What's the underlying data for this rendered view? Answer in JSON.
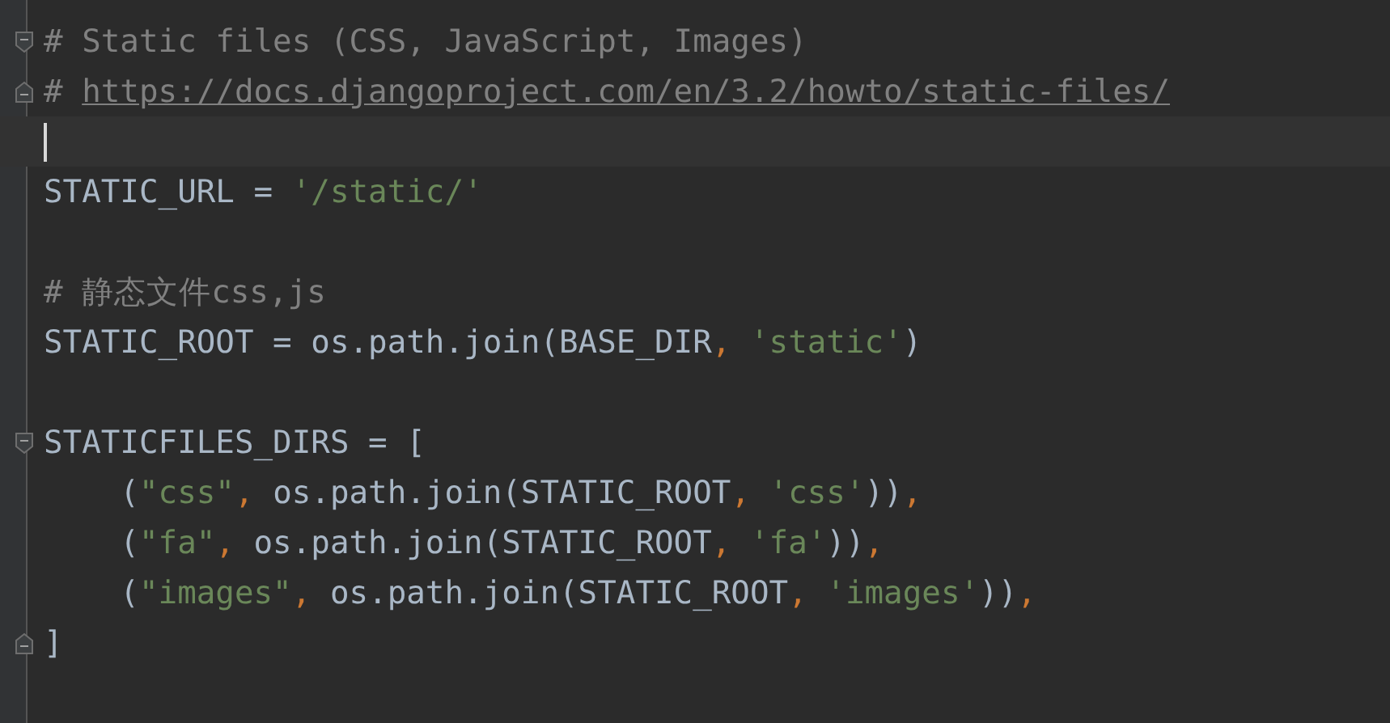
{
  "editor": {
    "lines": [
      {
        "current": false,
        "fold_start": true,
        "fold_end": false,
        "tokens": [
          {
            "kind": "comment",
            "text": "# Static files (CSS, JavaScript, Images)"
          }
        ]
      },
      {
        "current": false,
        "fold_start": false,
        "fold_end": true,
        "tokens": [
          {
            "kind": "comment",
            "text": "# "
          },
          {
            "kind": "link",
            "text": "https://docs.djangoproject.com/en/3.2/howto/static-files/"
          }
        ]
      },
      {
        "current": true,
        "fold_start": false,
        "fold_end": false
      },
      {
        "current": false,
        "fold_start": false,
        "fold_end": false,
        "tokens": [
          {
            "kind": "plain",
            "text": "STATIC_URL = "
          },
          {
            "kind": "string",
            "text": "'/static/'"
          }
        ]
      },
      {
        "current": false,
        "fold_start": false,
        "fold_end": false
      },
      {
        "current": false,
        "fold_start": false,
        "fold_end": false,
        "tokens": [
          {
            "kind": "comment",
            "text": "# 静态文件css,js"
          }
        ]
      },
      {
        "current": false,
        "fold_start": false,
        "fold_end": false,
        "tokens": [
          {
            "kind": "plain",
            "text": "STATIC_ROOT = os.path.join(BASE_DIR"
          },
          {
            "kind": "punct",
            "text": ", "
          },
          {
            "kind": "string",
            "text": "'static'"
          },
          {
            "kind": "plain",
            "text": ")"
          }
        ]
      },
      {
        "current": false,
        "fold_start": false,
        "fold_end": false
      },
      {
        "current": false,
        "fold_start": true,
        "fold_end": false,
        "tokens": [
          {
            "kind": "plain",
            "text": "STATICFILES_DIRS = ["
          }
        ]
      },
      {
        "current": false,
        "fold_start": false,
        "fold_end": false,
        "tokens": [
          {
            "kind": "plain",
            "text": "    ("
          },
          {
            "kind": "string",
            "text": "\"css\""
          },
          {
            "kind": "punct",
            "text": ", "
          },
          {
            "kind": "plain",
            "text": "os.path.join(STATIC_ROOT"
          },
          {
            "kind": "punct",
            "text": ", "
          },
          {
            "kind": "string",
            "text": "'css'"
          },
          {
            "kind": "plain",
            "text": "))"
          },
          {
            "kind": "punct",
            "text": ","
          }
        ]
      },
      {
        "current": false,
        "fold_start": false,
        "fold_end": false,
        "tokens": [
          {
            "kind": "plain",
            "text": "    ("
          },
          {
            "kind": "string",
            "text": "\"fa\""
          },
          {
            "kind": "punct",
            "text": ", "
          },
          {
            "kind": "plain",
            "text": "os.path.join(STATIC_ROOT"
          },
          {
            "kind": "punct",
            "text": ", "
          },
          {
            "kind": "string",
            "text": "'fa'"
          },
          {
            "kind": "plain",
            "text": "))"
          },
          {
            "kind": "punct",
            "text": ","
          }
        ]
      },
      {
        "current": false,
        "fold_start": false,
        "fold_end": false,
        "tokens": [
          {
            "kind": "plain",
            "text": "    ("
          },
          {
            "kind": "string",
            "text": "\"images\""
          },
          {
            "kind": "punct",
            "text": ", "
          },
          {
            "kind": "plain",
            "text": "os.path.join(STATIC_ROOT"
          },
          {
            "kind": "punct",
            "text": ", "
          },
          {
            "kind": "string",
            "text": "'images'"
          },
          {
            "kind": "plain",
            "text": "))"
          },
          {
            "kind": "punct",
            "text": ","
          }
        ]
      },
      {
        "current": false,
        "fold_start": false,
        "fold_end": true,
        "tokens": [
          {
            "kind": "plain",
            "text": "]"
          }
        ]
      }
    ]
  }
}
